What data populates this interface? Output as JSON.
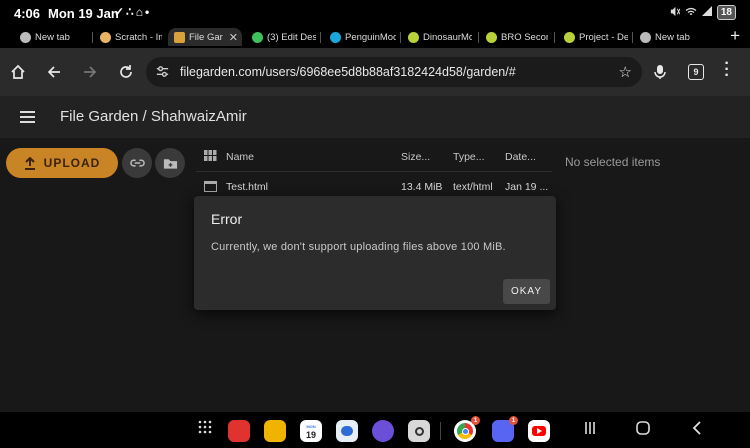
{
  "status_bar": {
    "time": "4:06",
    "date": "Mon 19 Jan",
    "notification_icons": "✓∴⌂•",
    "system_icons": "♪ ≈ ▮",
    "battery": "18"
  },
  "tabs": [
    {
      "label": "New tab",
      "favicon_color": "#bbbbbb",
      "active": false
    },
    {
      "label": "Scratch - Im",
      "favicon_color": "#e8b463",
      "active": false
    },
    {
      "label": "File Gar",
      "favicon_color": "#d9a13b",
      "active": true
    },
    {
      "label": "(3) Edit Des",
      "favicon_color": "#3fc15b",
      "active": false
    },
    {
      "label": "PenguinMod",
      "favicon_color": "#1aa6d8",
      "active": false
    },
    {
      "label": "DinosaurMod",
      "favicon_color": "#b8d13a",
      "active": false
    },
    {
      "label": "BRO Secon",
      "favicon_color": "#b8d13a",
      "active": false
    },
    {
      "label": "Project - De",
      "favicon_color": "#b8d13a",
      "active": false
    },
    {
      "label": "New tab",
      "favicon_color": "#bbbbbb",
      "active": false
    }
  ],
  "toolbar": {
    "url": "filegarden.com/users/6968ee5d8b88af3182424d58/garden/#",
    "tab_count": "9"
  },
  "app": {
    "title": "File Garden / ShahwaizAmir",
    "upload_label": "UPLOAD",
    "columns": {
      "name": "Name",
      "size": "Size...",
      "type": "Type...",
      "date": "Date..."
    },
    "files": [
      {
        "name": "Test.html",
        "size": "13.4 MiB",
        "type": "text/html",
        "date": "Jan 19 ..."
      }
    ],
    "no_selection": "No selected items"
  },
  "dialog": {
    "title": "Error",
    "message": "Currently, we don't support uploading files above 100 MiB.",
    "button": "OKAY"
  },
  "taskbar": {
    "calendar_day": "19",
    "calendar_month": "MON",
    "chrome_badge": "1",
    "discord_badge": "1"
  },
  "colors": {
    "accent": "#c98425",
    "dialog_bg": "#2c2c2c",
    "app_bg": "#181818"
  }
}
